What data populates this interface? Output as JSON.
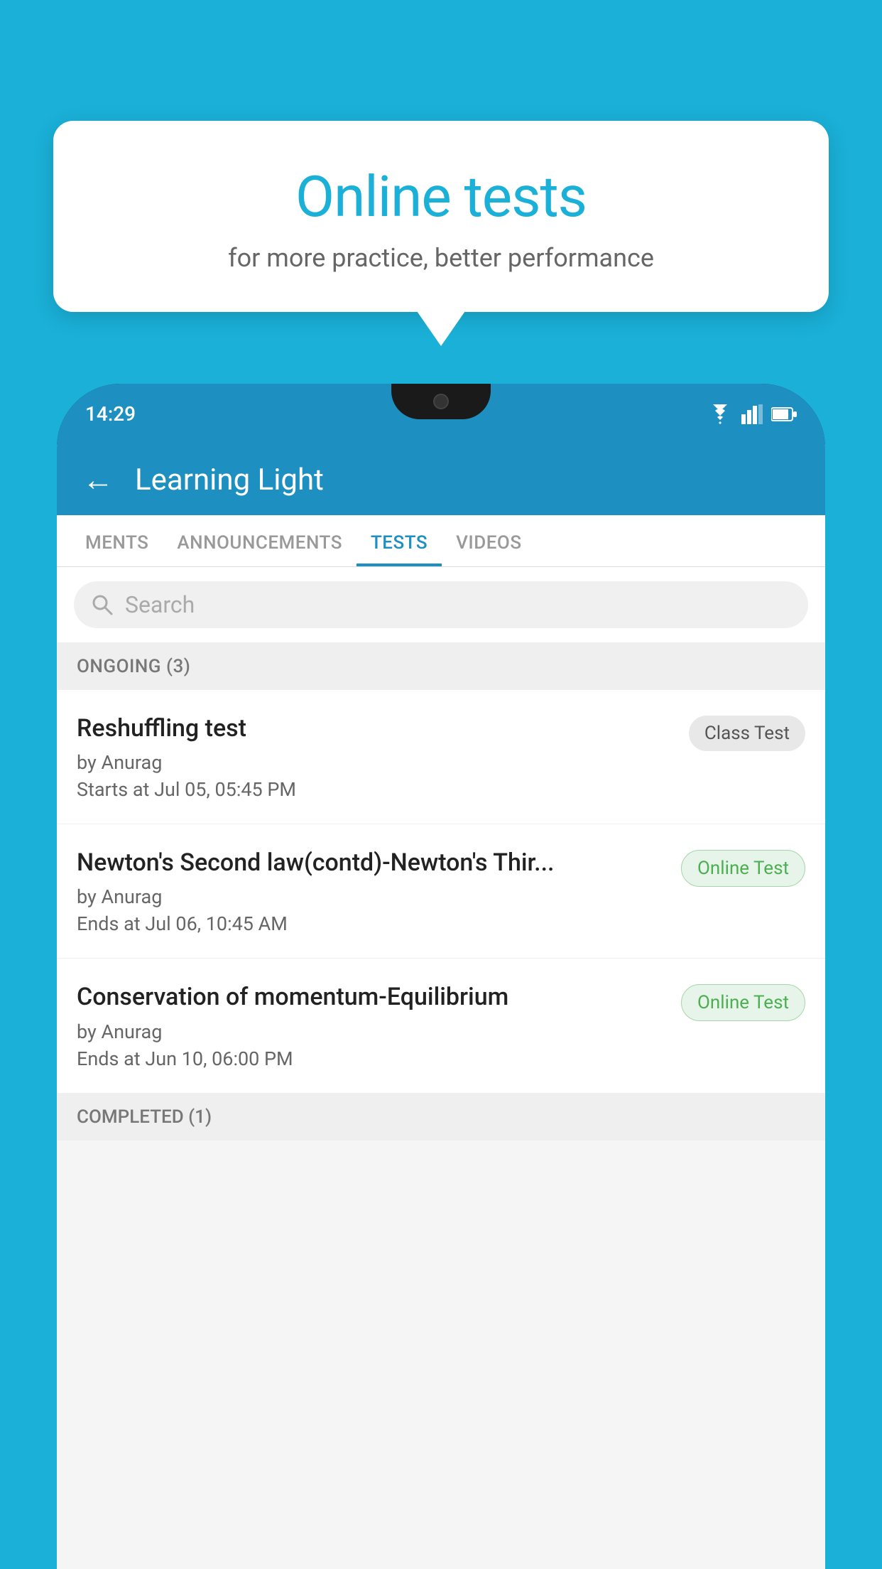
{
  "background_color": "#1ab0d8",
  "bubble": {
    "title": "Online tests",
    "subtitle": "for more practice, better performance"
  },
  "phone": {
    "status_time": "14:29",
    "app_title": "Learning Light",
    "back_label": "←",
    "tabs": [
      {
        "label": "MENTS",
        "active": false
      },
      {
        "label": "ANNOUNCEMENTS",
        "active": false
      },
      {
        "label": "TESTS",
        "active": true
      },
      {
        "label": "VIDEOS",
        "active": false
      }
    ],
    "search": {
      "placeholder": "Search"
    },
    "ongoing_section": "ONGOING (3)",
    "tests": [
      {
        "name": "Reshuffling test",
        "author": "by Anurag",
        "time_label": "Starts at",
        "time": "Jul 05, 05:45 PM",
        "badge": "Class Test",
        "badge_type": "class"
      },
      {
        "name": "Newton's Second law(contd)-Newton's Thir...",
        "author": "by Anurag",
        "time_label": "Ends at",
        "time": "Jul 06, 10:45 AM",
        "badge": "Online Test",
        "badge_type": "online"
      },
      {
        "name": "Conservation of momentum-Equilibrium",
        "author": "by Anurag",
        "time_label": "Ends at",
        "time": "Jun 10, 06:00 PM",
        "badge": "Online Test",
        "badge_type": "online"
      }
    ],
    "completed_section": "COMPLETED (1)"
  }
}
